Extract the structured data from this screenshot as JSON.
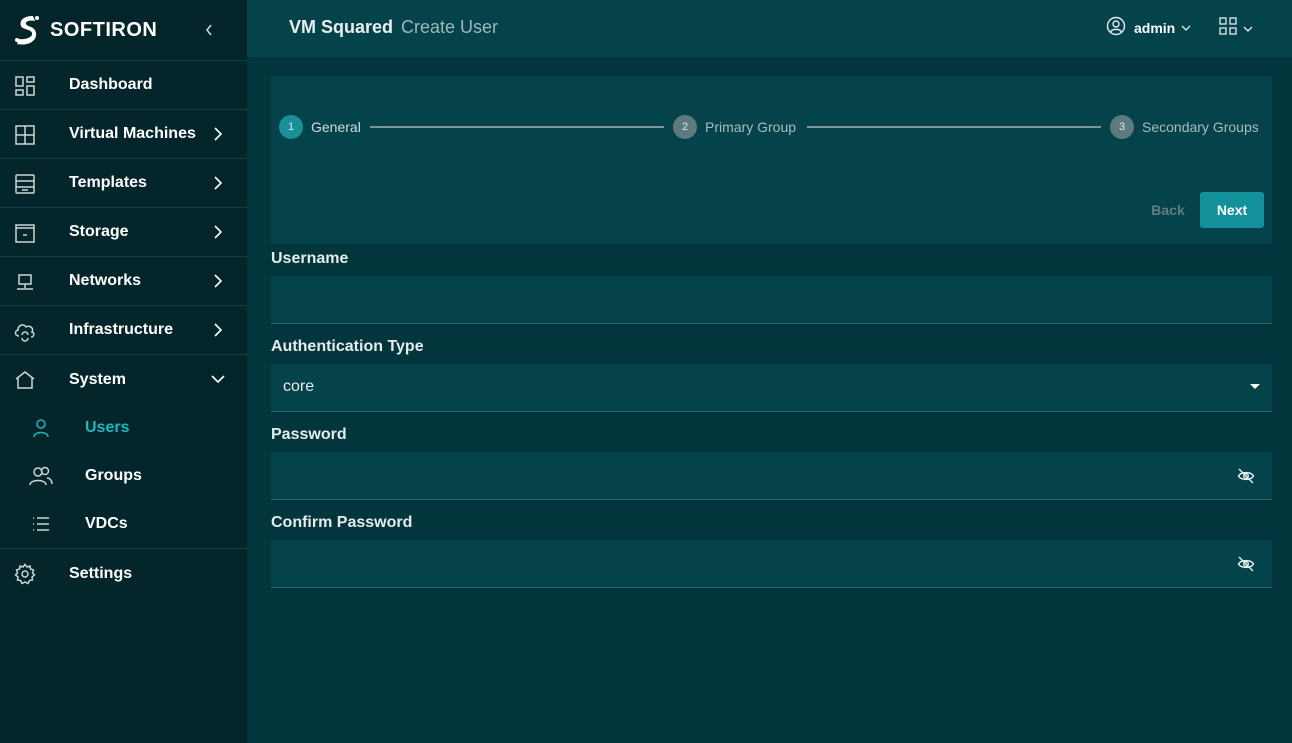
{
  "brand": {
    "name": "SOFTIRON"
  },
  "sidebar": {
    "items": [
      {
        "label": "Dashboard",
        "icon": "dashboard-icon",
        "chevron": false
      },
      {
        "label": "Virtual Machines",
        "icon": "grid-icon",
        "chevron": "right"
      },
      {
        "label": "Templates",
        "icon": "templates-icon",
        "chevron": "right"
      },
      {
        "label": "Storage",
        "icon": "storage-icon",
        "chevron": "right"
      },
      {
        "label": "Networks",
        "icon": "network-icon",
        "chevron": "right"
      },
      {
        "label": "Infrastructure",
        "icon": "cloud-sync-icon",
        "chevron": "right"
      },
      {
        "label": "System",
        "icon": "home-icon",
        "chevron": "down"
      }
    ],
    "system_children": [
      {
        "label": "Users",
        "icon": "user-icon",
        "active": true
      },
      {
        "label": "Groups",
        "icon": "users-icon",
        "active": false
      },
      {
        "label": "VDCs",
        "icon": "list-icon",
        "active": false
      }
    ],
    "settings": {
      "label": "Settings",
      "icon": "gear-icon"
    }
  },
  "header": {
    "app": "VM Squared",
    "page": "Create User",
    "user": "admin"
  },
  "stepper": {
    "steps": [
      {
        "number": "1",
        "label": "General",
        "state": "active"
      },
      {
        "number": "2",
        "label": "Primary Group",
        "state": "inactive"
      },
      {
        "number": "3",
        "label": "Secondary Groups",
        "state": "inactive"
      }
    ],
    "back_label": "Back",
    "next_label": "Next"
  },
  "form": {
    "username": {
      "label": "Username",
      "value": ""
    },
    "auth_type": {
      "label": "Authentication Type",
      "value": "core"
    },
    "password": {
      "label": "Password",
      "value": ""
    },
    "confirm_password": {
      "label": "Confirm Password",
      "value": ""
    }
  },
  "colors": {
    "accent": "#12919a",
    "active_nav": "#20b6c0",
    "sidebar_bg": "#04262b",
    "content_bg": "#03353c",
    "panel_bg": "#04434a"
  }
}
